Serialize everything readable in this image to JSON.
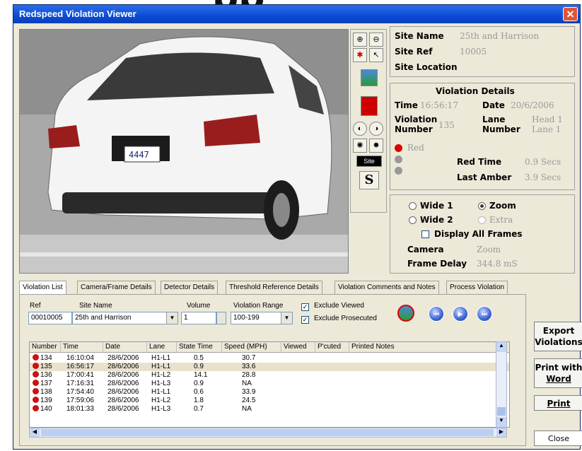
{
  "window": {
    "title": "Redspeed Violation Viewer",
    "close_glyph": "✕"
  },
  "background_text": "pp",
  "photo": {
    "plate_text": "4447"
  },
  "toolbar": {
    "site_btn": "Site",
    "s_btn": "S"
  },
  "site": {
    "name_label": "Site Name",
    "name_value": "25th and Harrison",
    "ref_label": "Site Ref",
    "ref_value": "10005",
    "location_label": "Site Location"
  },
  "violation_details": {
    "heading": "Violation Details",
    "time_label": "Time",
    "time_value": "16:56:17",
    "date_label": "Date",
    "date_value": "20/6/2006",
    "number_label_1": "Violation",
    "number_label_2": "Number",
    "number_value": "135",
    "lane_label_1": "Lane",
    "lane_label_2": "Number",
    "lane_value_1": "Head 1",
    "lane_value_2": "Lane 1",
    "red_label": "Red",
    "red_time_label": "Red Time",
    "red_time_value": "0.9 Secs",
    "last_amber_label": "Last Amber",
    "last_amber_value": "3.9 Secs"
  },
  "view_options": {
    "wide1": "Wide 1",
    "zoom": "Zoom",
    "wide2": "Wide 2",
    "extra": "Extra",
    "display_all": "Display All Frames",
    "camera_label": "Camera",
    "camera_value": "Zoom",
    "frame_delay_label": "Frame Delay",
    "frame_delay_value": "344.8 mS"
  },
  "tabs": [
    "Violation List",
    "Camera/Frame Details",
    "Detector Details",
    "Threshold Reference Details",
    "Violation Comments and Notes",
    "Process Violation"
  ],
  "filters": {
    "ref_label": "Ref",
    "ref_value": "00010005",
    "site_label": "Site Name",
    "site_value": "25th and Harrison",
    "volume_label": "Volume",
    "volume_value": "1",
    "range_label": "Violation Range",
    "range_value": "100-199",
    "exclude_viewed": "Exclude Viewed",
    "exclude_prosecuted": "Exclude Prosecuted"
  },
  "nav": {
    "first": "⏮",
    "play": "▶",
    "last": "⏭"
  },
  "table": {
    "headers": [
      "Number",
      "Time",
      "Date",
      "Lane",
      "State Time",
      "Speed (MPH)",
      "Viewed",
      "P'cuted",
      "Printed Notes"
    ],
    "rows": [
      [
        "134",
        "16:10:04",
        "28/6/2006",
        "H1-L1",
        "0.5",
        "30.7"
      ],
      [
        "135",
        "16:56:17",
        "28/6/2006",
        "H1-L1",
        "0.9",
        "33.6"
      ],
      [
        "136",
        "17:00:41",
        "28/6/2006",
        "H1-L2",
        "14.1",
        "28.8"
      ],
      [
        "137",
        "17:16:31",
        "28/6/2006",
        "H1-L3",
        "0.9",
        "NA"
      ],
      [
        "138",
        "17:54:40",
        "28/6/2006",
        "H1-L1",
        "0.6",
        "33.9"
      ],
      [
        "139",
        "17:59:06",
        "28/6/2006",
        "H1-L2",
        "1.8",
        "24.5"
      ],
      [
        "140",
        "18:01:33",
        "28/6/2006",
        "H1-L3",
        "0.7",
        "NA"
      ]
    ]
  },
  "buttons": {
    "export_1": "Export",
    "export_2": "Violations",
    "print_word_1": "Print with",
    "print_word_2": "Word",
    "print": "Print",
    "close": "Close"
  }
}
